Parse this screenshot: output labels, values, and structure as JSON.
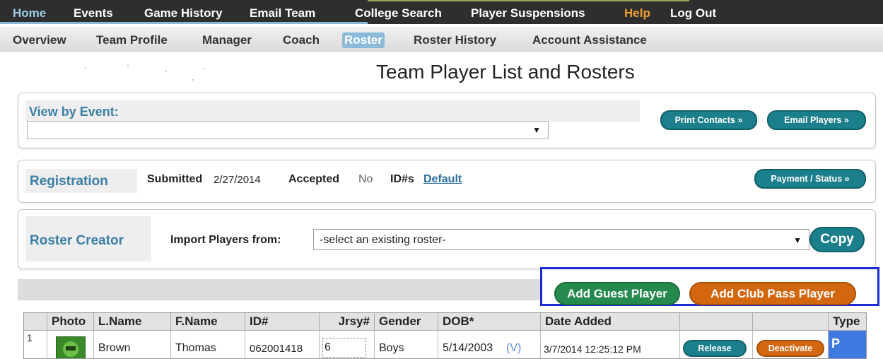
{
  "top_nav": {
    "items": [
      "Home",
      "Events",
      "Game History",
      "Email Team",
      "College Search",
      "Player Suspensions",
      "Help",
      "Log Out"
    ]
  },
  "sub_nav": {
    "items": [
      "Overview",
      "Team Profile",
      "Manager",
      "Coach",
      "Roster",
      "Roster History",
      "Account Assistance"
    ],
    "active": "Roster"
  },
  "page_title": "Team Player List and Rosters",
  "view_by_event": {
    "label": "View by Event:",
    "select_value": "",
    "print_contacts": "Print Contacts »",
    "email_players": "Email Players »"
  },
  "registration": {
    "label": "Registration",
    "submitted_label": "Submitted",
    "submitted_value": "2/27/2014",
    "accepted_label": "Accepted",
    "accepted_value": "No",
    "ids_label": "ID#s",
    "ids_value": "Default",
    "payment_status": "Payment / Status »"
  },
  "roster_creator": {
    "label": "Roster Creator",
    "import_label": "Import Players from:",
    "import_select": "-select an existing roster-",
    "copy": "Copy"
  },
  "actions": {
    "add_guest": "Add Guest Player",
    "add_club_pass": "Add Club Pass Player"
  },
  "table": {
    "headers": [
      "",
      "Photo",
      "L.Name",
      "F.Name",
      "ID#",
      "Jrsy#",
      "Gender",
      "DOB*",
      "Date Added",
      "",
      "",
      "Type"
    ],
    "rows": [
      {
        "num": "1",
        "lname": "Brown",
        "fname": "Thomas",
        "id": "062001418",
        "jersey": "6",
        "gender": "Boys",
        "dob": "5/14/2003",
        "dob_flag": "(V)",
        "date_added": "3/7/2014 12:25:12 PM",
        "release": "Release",
        "deactivate": "Deactivate",
        "type": "P"
      }
    ]
  },
  "colors": {
    "nav_bg": "#2e2e2e",
    "accent_teal": "#1c7f8c",
    "accent_green": "#268a4e",
    "accent_orange": "#d2670f",
    "highlight_blue": "#1a2bd3",
    "label_blue": "#3a7fa6",
    "type_blue": "#3f79e0"
  }
}
